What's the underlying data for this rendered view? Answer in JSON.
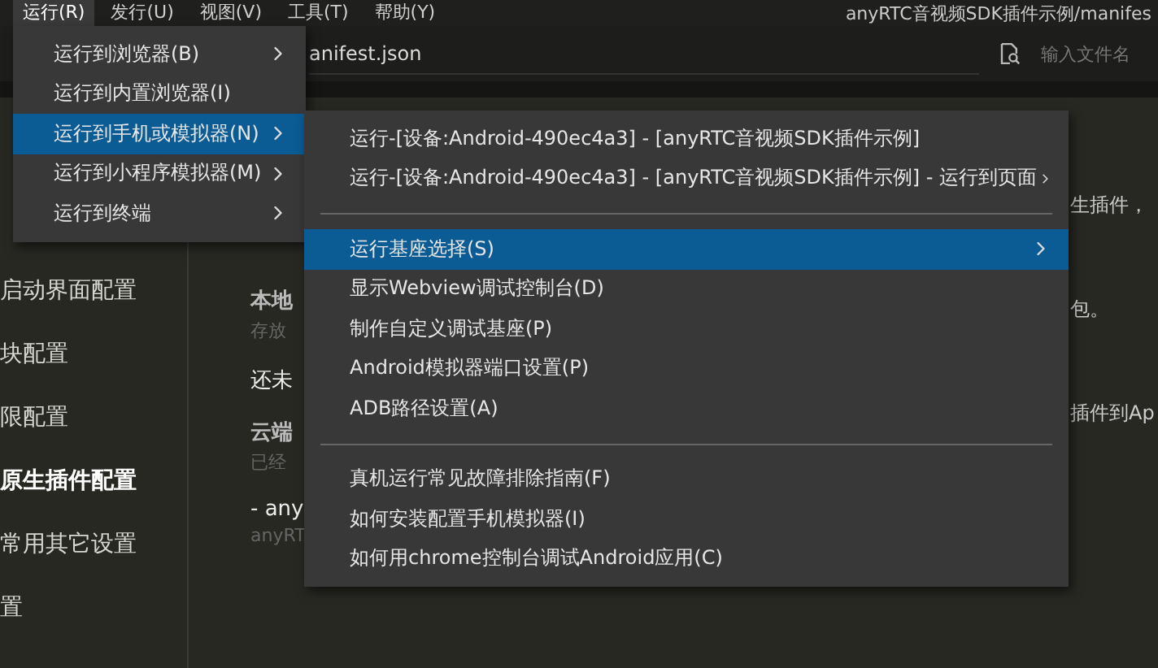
{
  "menubar": {
    "items": [
      {
        "label": "运行(R)",
        "selected": true
      },
      {
        "label": "发行(U)",
        "selected": false
      },
      {
        "label": "视图(V)",
        "selected": false
      },
      {
        "label": "工具(T)",
        "selected": false
      },
      {
        "label": "帮助(Y)",
        "selected": false
      }
    ],
    "title": "anyRTC音视频SDK插件示例/manifes"
  },
  "toolbar": {
    "path": "anifest.json",
    "search": {
      "placeholder": "输入文件名"
    }
  },
  "sidebar": {
    "items": [
      {
        "label": "启动界面配置",
        "selected": false
      },
      {
        "label": "块配置",
        "selected": false
      },
      {
        "label": "限配置",
        "selected": false
      },
      {
        "label": "原生插件配置",
        "selected": true
      },
      {
        "label": "常用其它设置",
        "selected": false
      },
      {
        "label": "置",
        "selected": false
      }
    ]
  },
  "content": {
    "left": [
      {
        "kind": "heading",
        "text": "本地"
      },
      {
        "kind": "note",
        "text": "存放"
      },
      {
        "kind": "text",
        "text": "还未"
      },
      {
        "kind": "heading",
        "text": "云端"
      },
      {
        "kind": "note",
        "text": "已经"
      },
      {
        "kind": "text",
        "text": "- any"
      },
      {
        "kind": "note",
        "text": "anyRT"
      }
    ],
    "right": [
      "生插件，",
      "包。",
      "插件到Ap"
    ]
  },
  "run_menu": {
    "items": [
      {
        "label": "运行到浏览器(B)",
        "has_submenu": true,
        "selected": false
      },
      {
        "label": "运行到内置浏览器(I)",
        "has_submenu": false,
        "selected": false
      },
      {
        "label": "运行到手机或模拟器(N)",
        "has_submenu": true,
        "selected": true
      },
      {
        "label": "运行到小程序模拟器(M)",
        "has_submenu": true,
        "selected": false
      },
      {
        "label": "运行到终端",
        "has_submenu": true,
        "selected": false
      }
    ]
  },
  "device_menu": {
    "groups": [
      [
        {
          "label": "运行-[设备:Android-490ec4a3] - [anyRTC音视频SDK插件示例]",
          "has_submenu": false,
          "selected": false
        },
        {
          "label": "运行-[设备:Android-490ec4a3] - [anyRTC音视频SDK插件示例] - 运行到页面",
          "has_submenu": true,
          "selected": false
        }
      ],
      [
        {
          "label": "运行基座选择(S)",
          "has_submenu": true,
          "selected": true
        },
        {
          "label": "显示Webview调试控制台(D)",
          "has_submenu": false,
          "selected": false
        },
        {
          "label": "制作自定义调试基座(P)",
          "has_submenu": false,
          "selected": false
        },
        {
          "label": "Android模拟器端口设置(P)",
          "has_submenu": false,
          "selected": false
        },
        {
          "label": "ADB路径设置(A)",
          "has_submenu": false,
          "selected": false
        }
      ],
      [
        {
          "label": "真机运行常见故障排除指南(F)",
          "has_submenu": false,
          "selected": false
        },
        {
          "label": "如何安装配置手机模拟器(I)",
          "has_submenu": false,
          "selected": false
        },
        {
          "label": "如何用chrome控制台调试Android应用(C)",
          "has_submenu": false,
          "selected": false
        }
      ]
    ]
  }
}
